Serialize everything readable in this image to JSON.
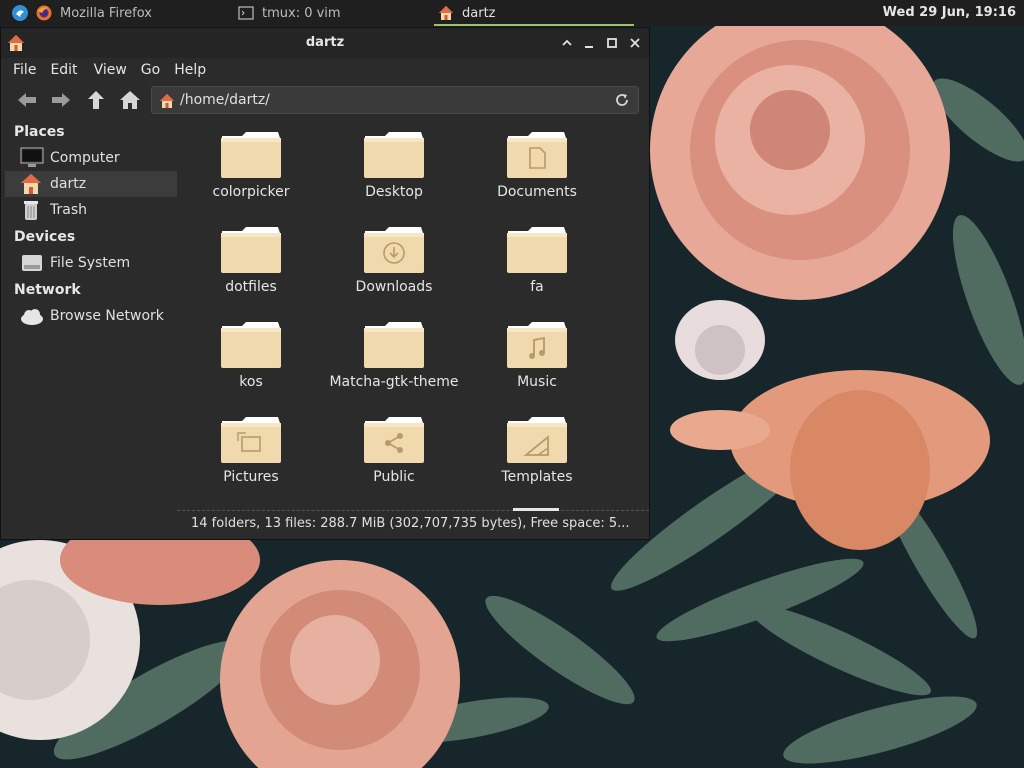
{
  "taskbar": {
    "tasks": [
      {
        "label": "Mozilla Firefox"
      },
      {
        "label": "tmux: 0 vim"
      },
      {
        "label": "dartz"
      }
    ],
    "clock": "Wed 29 Jun, 19:16"
  },
  "window": {
    "title": "dartz",
    "menu": [
      "File",
      "Edit",
      "View",
      "Go",
      "Help"
    ],
    "address": "/home/dartz/",
    "sidebar": {
      "places_label": "Places",
      "places": [
        "Computer",
        "dartz",
        "Trash"
      ],
      "devices_label": "Devices",
      "devices": [
        "File System"
      ],
      "network_label": "Network",
      "network": [
        "Browse Network"
      ]
    },
    "files": [
      {
        "name": "colorpicker",
        "icon": "folder-icon"
      },
      {
        "name": "Desktop",
        "icon": "folder-icon"
      },
      {
        "name": "Documents",
        "icon": "folder-documents-icon"
      },
      {
        "name": "dotfiles",
        "icon": "folder-icon"
      },
      {
        "name": "Downloads",
        "icon": "folder-downloads-icon"
      },
      {
        "name": "fa",
        "icon": "folder-icon"
      },
      {
        "name": "kos",
        "icon": "folder-icon"
      },
      {
        "name": "Matcha-gtk-theme",
        "icon": "folder-icon"
      },
      {
        "name": "Music",
        "icon": "folder-music-icon"
      },
      {
        "name": "Pictures",
        "icon": "folder-pictures-icon"
      },
      {
        "name": "Public",
        "icon": "folder-public-icon"
      },
      {
        "name": "Templates",
        "icon": "folder-templates-icon"
      }
    ],
    "status": "14 folders, 13 files: 288.7 MiB (302,707,735 bytes), Free space: 5..."
  },
  "colors": {
    "window_bg": "#2b2b2b",
    "titlebar_bg": "#252525",
    "folder_tan": "#f0d9ad",
    "accent_green": "#9fbf6a"
  }
}
